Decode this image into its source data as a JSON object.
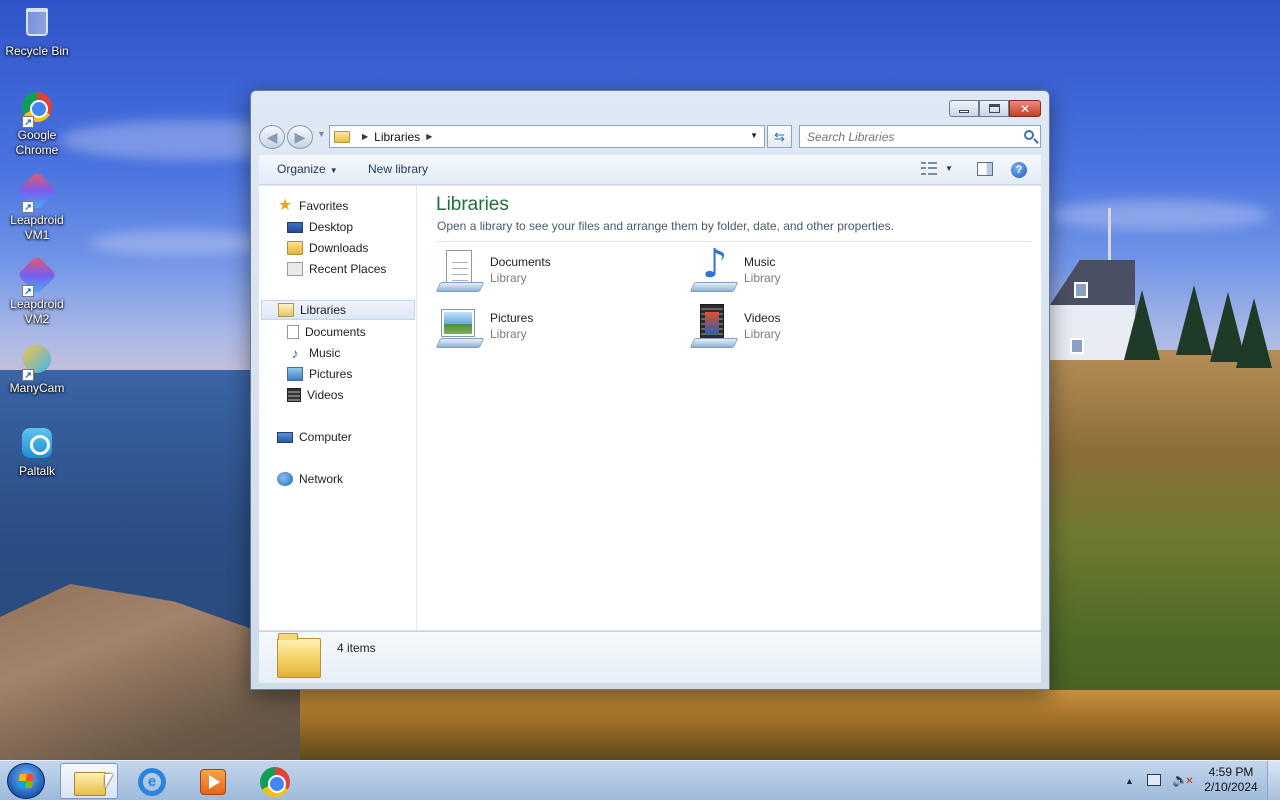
{
  "desktop": {
    "icons": [
      {
        "label": "Recycle Bin",
        "icon": "recycle-bin-icon"
      },
      {
        "label": "Google\nChrome",
        "icon": "chrome-icon"
      },
      {
        "label": "Leapdroid\nVM1",
        "icon": "leapdroid-icon"
      },
      {
        "label": "Leapdroid\nVM2",
        "icon": "leapdroid-icon"
      },
      {
        "label": "ManyCam",
        "icon": "manycam-icon"
      },
      {
        "label": "Paltalk",
        "icon": "paltalk-icon"
      }
    ]
  },
  "window": {
    "address": {
      "crumb": "Libraries"
    },
    "search": {
      "placeholder": "Search Libraries"
    },
    "toolbar": {
      "organize": "Organize",
      "new_library": "New library"
    },
    "nav": {
      "favorites": "Favorites",
      "desktop": "Desktop",
      "downloads": "Downloads",
      "recent_places": "Recent Places",
      "libraries": "Libraries",
      "documents": "Documents",
      "music": "Music",
      "pictures": "Pictures",
      "videos": "Videos",
      "computer": "Computer",
      "network": "Network"
    },
    "content": {
      "title": "Libraries",
      "subtitle": "Open a library to see your files and arrange them by folder, date, and other properties.",
      "items": [
        {
          "name": "Documents",
          "kind": "Library"
        },
        {
          "name": "Music",
          "kind": "Library"
        },
        {
          "name": "Pictures",
          "kind": "Library"
        },
        {
          "name": "Videos",
          "kind": "Library"
        }
      ]
    },
    "details": {
      "count": "4 items"
    }
  },
  "taskbar": {
    "pinned": [
      "windows-explorer",
      "internet-explorer",
      "windows-media-player",
      "google-chrome"
    ],
    "clock": {
      "time": "4:59 PM",
      "date": "2/10/2024"
    }
  }
}
